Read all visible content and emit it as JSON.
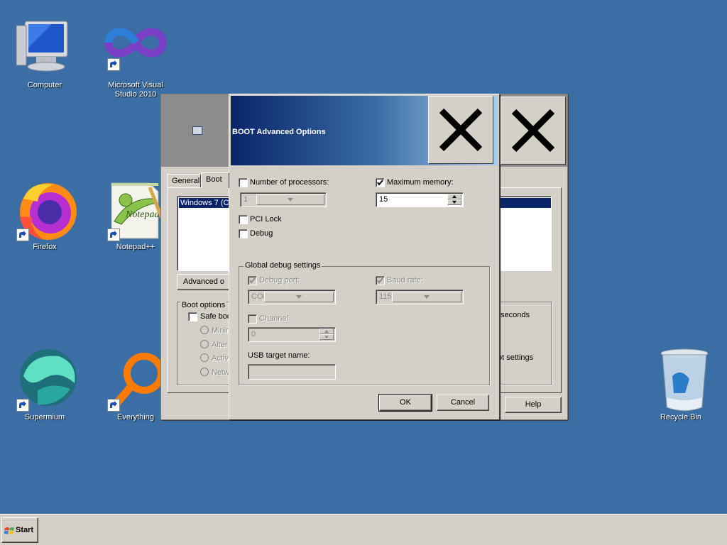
{
  "desktop": {
    "icons": [
      {
        "label": "Computer",
        "icon": "computer-icon"
      },
      {
        "label": "Microsoft Visual Studio 2010",
        "icon": "visual-studio-icon"
      },
      {
        "label": "Firefox",
        "icon": "firefox-icon"
      },
      {
        "label": "Notepad++",
        "icon": "notepad-plus-plus-icon"
      },
      {
        "label": "Supermium",
        "icon": "supermium-icon"
      },
      {
        "label": "Everything",
        "icon": "everything-icon"
      },
      {
        "label": "Recycle Bin",
        "icon": "recycle-bin-icon"
      }
    ]
  },
  "system_config": {
    "tabs": [
      "General",
      "Boot"
    ],
    "active_tab": "Boot",
    "os_entry": "Windows 7 (C:",
    "advanced_button": "Advanced o",
    "boot_options_label": "Boot options",
    "safe_boot_label": "Safe boo",
    "safe_boot_options": [
      "Minim",
      "Alter",
      "Activ",
      "Netw"
    ],
    "timeout_unit": "seconds",
    "permanent_label": "ot settings",
    "help_button": "Help"
  },
  "advanced_options": {
    "title": "BOOT Advanced Options",
    "num_processors": {
      "label": "Number of processors:",
      "checked": false,
      "value": "1"
    },
    "max_memory": {
      "label": "Maximum memory:",
      "checked": true,
      "value": "15"
    },
    "pci_lock": {
      "label": "PCI Lock",
      "checked": false
    },
    "debug": {
      "label": "Debug",
      "checked": false
    },
    "global_debug": {
      "title": "Global debug settings",
      "debug_port": {
        "label": "Debug port:",
        "value": "COM"
      },
      "baud_rate": {
        "label": "Baud rate:",
        "value": "115"
      },
      "channel": {
        "label": "Channel",
        "value": "0"
      },
      "usb_target": {
        "label": "USB target name:",
        "value": ""
      }
    },
    "ok_button": "OK",
    "cancel_button": "Cancel"
  },
  "taskbar": {
    "start_label": "Start"
  },
  "colors": {
    "desktop": "#3a6ea5",
    "face": "#d4d0c8",
    "selection": "#0a246a"
  }
}
